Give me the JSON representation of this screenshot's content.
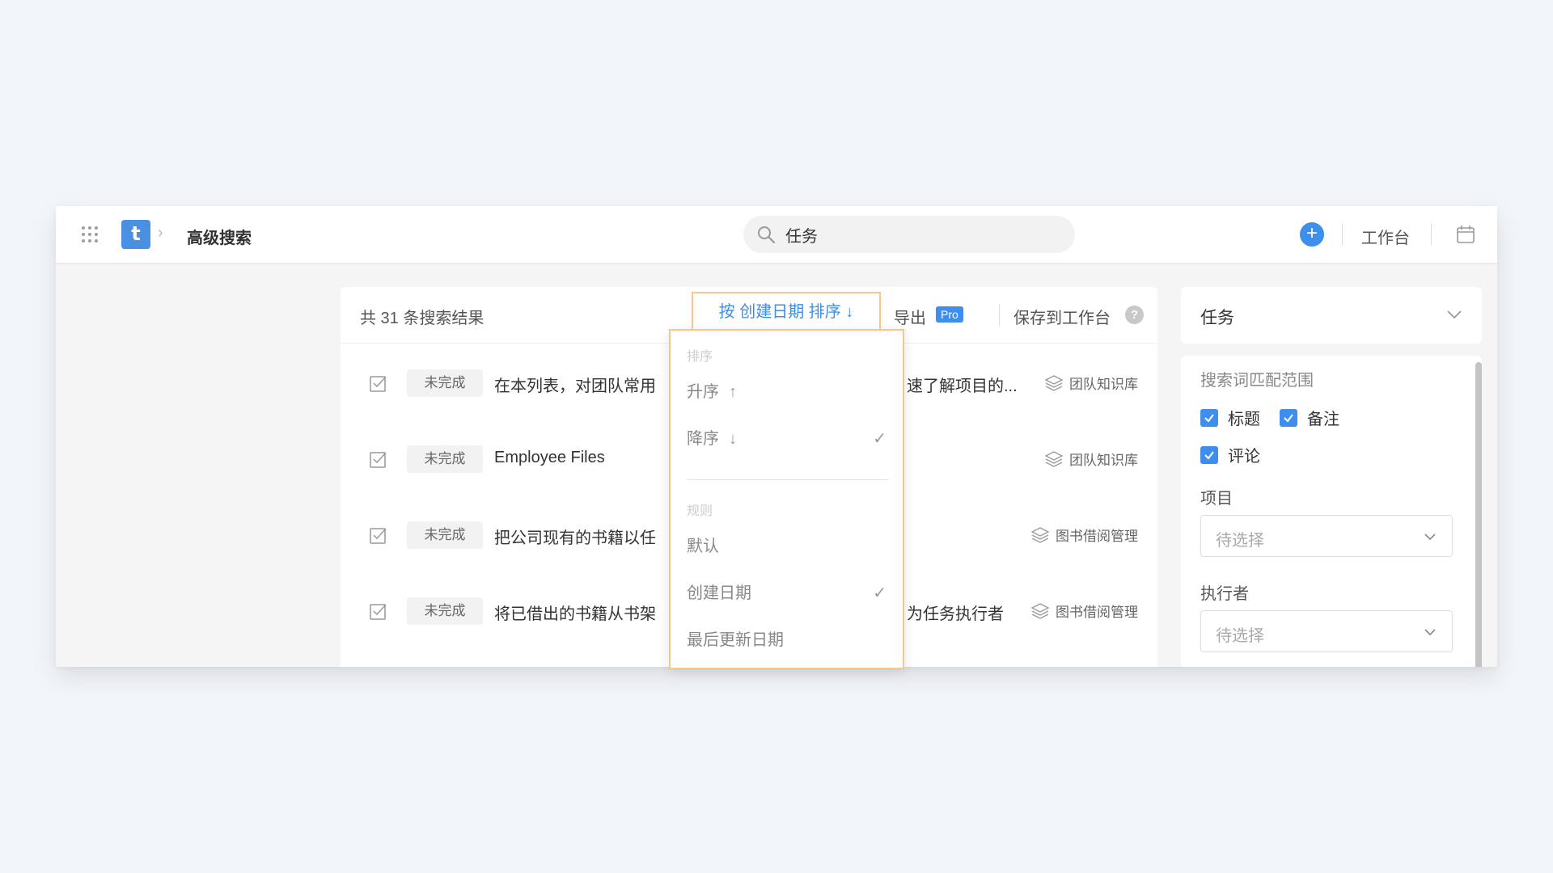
{
  "header": {
    "logo_letter": "t",
    "breadcrumb_title": "高级搜索",
    "search_value": "任务",
    "add_label": "+",
    "workbench_label": "工作台"
  },
  "results": {
    "count_label": "共 31 条搜索结果",
    "sort_label": "按 创建日期 排序 ↓",
    "export_label": "导出",
    "pro_badge": "Pro",
    "save_label": "保存到工作台",
    "help_label": "?",
    "rows": [
      {
        "status": "未完成",
        "title": "在本列表，对团队常用",
        "title_tail": "速了解项目的...",
        "project": "团队知识库"
      },
      {
        "status": "未完成",
        "title": "Employee Files",
        "title_tail": "",
        "project": "团队知识库"
      },
      {
        "status": "未完成",
        "title": "把公司现有的书籍以任",
        "title_tail": "",
        "project": "图书借阅管理"
      },
      {
        "status": "未完成",
        "title": "将已借出的书籍从书架",
        "title_tail": "为任务执行者",
        "project": "图书借阅管理"
      }
    ]
  },
  "sort_menu": {
    "order_group": "排序",
    "asc_label": "升序",
    "asc_arrow": "↑",
    "desc_label": "降序",
    "desc_arrow": "↓",
    "rule_group": "规则",
    "rules": [
      "默认",
      "创建日期",
      "最后更新日期"
    ],
    "selected_order": "降序",
    "selected_rule": "创建日期",
    "tick": "✓"
  },
  "filter": {
    "type_value": "任务",
    "match_scope_label": "搜索词匹配范围",
    "checkboxes": [
      {
        "label": "标题",
        "checked": true
      },
      {
        "label": "备注",
        "checked": true
      },
      {
        "label": "评论",
        "checked": true
      }
    ],
    "project_label": "项目",
    "project_placeholder": "待选择",
    "executor_label": "执行者",
    "executor_placeholder": "待选择"
  },
  "colors": {
    "accent": "#3d8eed",
    "highlight_border": "#f5c78e",
    "background": "#f3f6f9"
  },
  "icons": [
    "apps-grid-icon",
    "chevron-right-icon",
    "search-icon",
    "plus-icon",
    "calendar-icon",
    "checkbox-task-icon",
    "layers-icon",
    "chevron-down-icon",
    "check-icon",
    "help-icon"
  ]
}
